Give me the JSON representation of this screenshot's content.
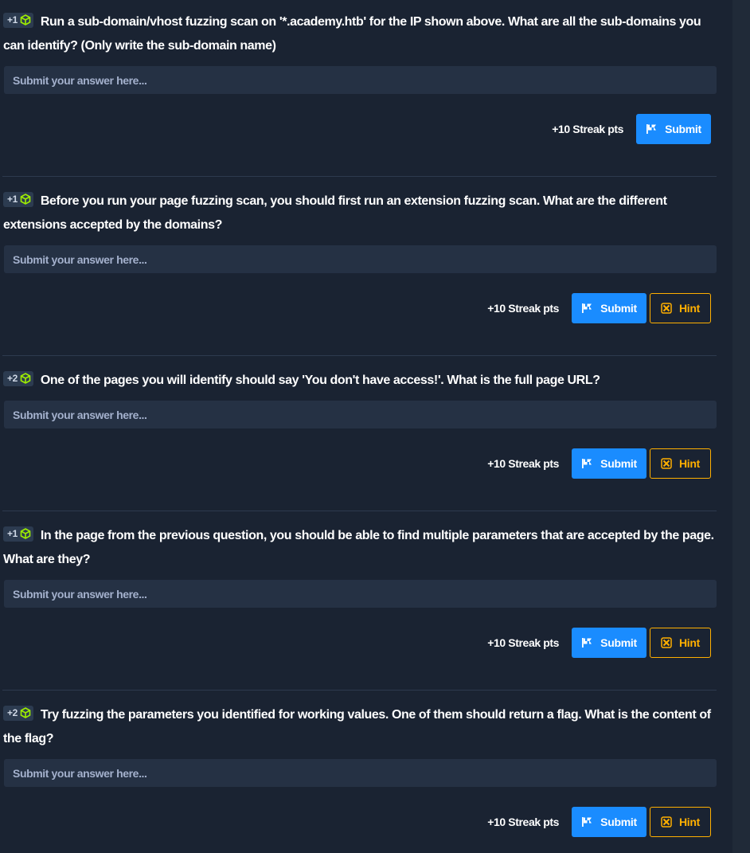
{
  "questions": [
    {
      "points": "+1",
      "text": "Run a sub-domain/vhost fuzzing scan on '*.academy.htb' for the IP shown above. What are all the sub-domains you can identify? (Only write the sub-domain name)",
      "placeholder": "Submit your answer here...",
      "streak": "+10 Streak pts",
      "submit_label": "Submit"
    },
    {
      "points": "+1",
      "text": "Before you run your page fuzzing scan, you should first run an extension fuzzing scan. What are the different extensions accepted by the domains?",
      "placeholder": "Submit your answer here...",
      "streak": "+10 Streak pts",
      "submit_label": "Submit",
      "hint_label": "Hint"
    },
    {
      "points": "+2",
      "text": "One of the pages you will identify should say 'You don't have access!'. What is the full page URL?",
      "placeholder": "Submit your answer here...",
      "streak": "+10 Streak pts",
      "submit_label": "Submit",
      "hint_label": "Hint"
    },
    {
      "points": "+1",
      "text": "In the page from the previous question, you should be able to find multiple parameters that are accepted by the page. What are they?",
      "placeholder": "Submit your answer here...",
      "streak": "+10 Streak pts",
      "submit_label": "Submit",
      "hint_label": "Hint"
    },
    {
      "points": "+2",
      "text": "Try fuzzing the parameters you identified for working values. One of them should return a flag. What is the content of the flag?",
      "placeholder": "Submit your answer here...",
      "streak": "+10 Streak pts",
      "submit_label": "Submit",
      "hint_label": "Hint"
    }
  ],
  "colors": {
    "background": "#1a2332",
    "input_bg": "#253144",
    "submit_blue": "#1a8cff",
    "hint_orange": "#ffaf00",
    "cube_green": "#9fef00"
  },
  "icons": {
    "badge": "cube-icon",
    "submit": "flag-icon",
    "hint": "hint-icon"
  }
}
